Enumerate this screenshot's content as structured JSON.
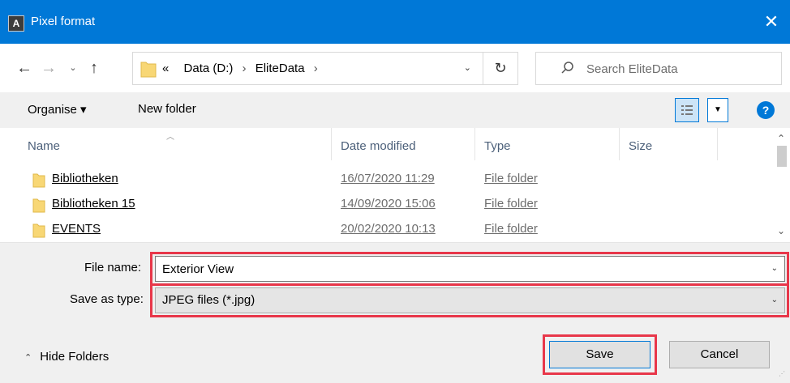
{
  "window": {
    "title": "Pixel format",
    "app_icon_glyph": "A",
    "close_glyph": "✕"
  },
  "nav": {
    "back_glyph": "←",
    "forward_glyph": "→",
    "recent_glyph": "⌄",
    "up_glyph": "↑",
    "breadcrumb_prefix": "«",
    "breadcrumbs": [
      "Data (D:)",
      "EliteData"
    ],
    "breadcrumb_separator": "›",
    "refresh_glyph": "↻",
    "search_placeholder": "Search EliteData"
  },
  "toolbar": {
    "organise_label": "Organise ▾",
    "new_folder_label": "New folder",
    "help_glyph": "?",
    "view_dropdown_glyph": "▼"
  },
  "filelist": {
    "columns": {
      "name": "Name",
      "date": "Date modified",
      "type": "Type",
      "size": "Size"
    },
    "rows": [
      {
        "name": "Bibliotheken",
        "date": "16/07/2020 11:29",
        "type": "File folder"
      },
      {
        "name": "Bibliotheken 15",
        "date": "14/09/2020 15:06",
        "type": "File folder"
      },
      {
        "name": "EVENTS",
        "date": "20/02/2020 10:13",
        "type": "File folder"
      }
    ]
  },
  "form": {
    "file_name_label": "File name:",
    "file_name_value": "Exterior View",
    "save_as_type_label": "Save as type:",
    "save_as_type_value": "JPEG files (*.jpg)"
  },
  "footer": {
    "hide_folders_label": "Hide Folders",
    "save_label": "Save",
    "cancel_label": "Cancel"
  },
  "colors": {
    "titlebar": "#0078d7",
    "highlight": "#e8374a",
    "folder": "#f8d775"
  },
  "icons": {
    "app": "app-icon",
    "close": "close-icon",
    "back": "arrow-left-icon",
    "forward": "arrow-right-icon",
    "up": "arrow-up-icon",
    "folder": "folder-icon",
    "search": "search-icon",
    "refresh": "refresh-icon",
    "help": "help-icon",
    "view": "details-view-icon"
  }
}
